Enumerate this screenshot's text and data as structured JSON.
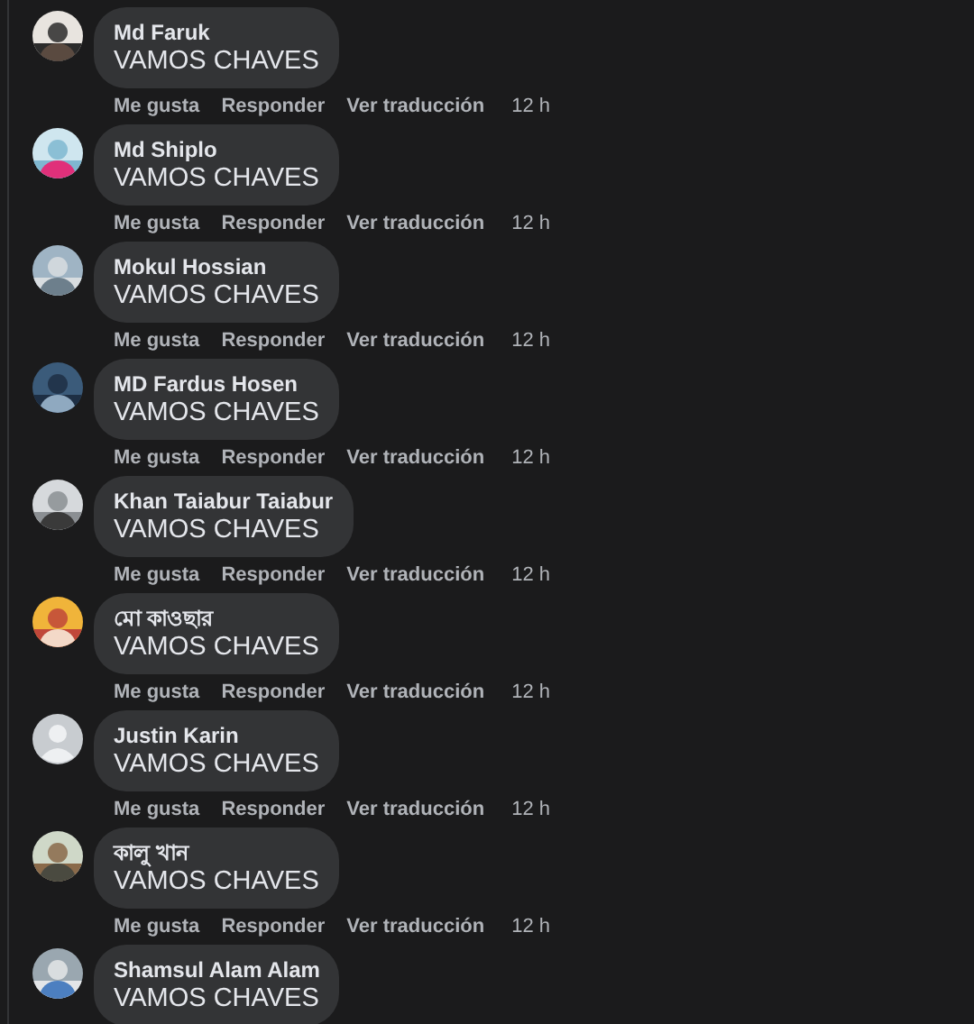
{
  "comments": [
    {
      "author": "Md Faruk",
      "text": "VAMOS CHAVES",
      "actions": [
        "Me gusta",
        "Responder",
        "Ver traducción"
      ],
      "time": "12 h"
    },
    {
      "author": "Md Shiplo",
      "text": "VAMOS CHAVES",
      "actions": [
        "Me gusta",
        "Responder",
        "Ver traducción"
      ],
      "time": "12 h"
    },
    {
      "author": "Mokul Hossian",
      "text": "VAMOS CHAVES",
      "actions": [
        "Me gusta",
        "Responder",
        "Ver traducción"
      ],
      "time": "12 h"
    },
    {
      "author": "MD Fardus Hosen",
      "text": "VAMOS CHAVES",
      "actions": [
        "Me gusta",
        "Responder",
        "Ver traducción"
      ],
      "time": "12 h"
    },
    {
      "author": "Khan Taiabur Taiabur",
      "text": "VAMOS CHAVES",
      "actions": [
        "Me gusta",
        "Responder",
        "Ver traducción"
      ],
      "time": "12 h"
    },
    {
      "author": "মো কাওছার",
      "text": "VAMOS CHAVES",
      "actions": [
        "Me gusta",
        "Responder",
        "Ver traducción"
      ],
      "time": "12 h"
    },
    {
      "author": "Justin Karin",
      "text": "VAMOS CHAVES",
      "avatar": {
        "kind": "default"
      },
      "actions": [
        "Me gusta",
        "Responder",
        "Ver traducción"
      ],
      "time": "12 h"
    },
    {
      "author": "কালু খান",
      "text": "VAMOS CHAVES",
      "actions": [
        "Me gusta",
        "Responder",
        "Ver traducción"
      ],
      "time": "12 h"
    },
    {
      "author": "Shamsul Alam Alam",
      "text": "VAMOS CHAVES"
    }
  ]
}
